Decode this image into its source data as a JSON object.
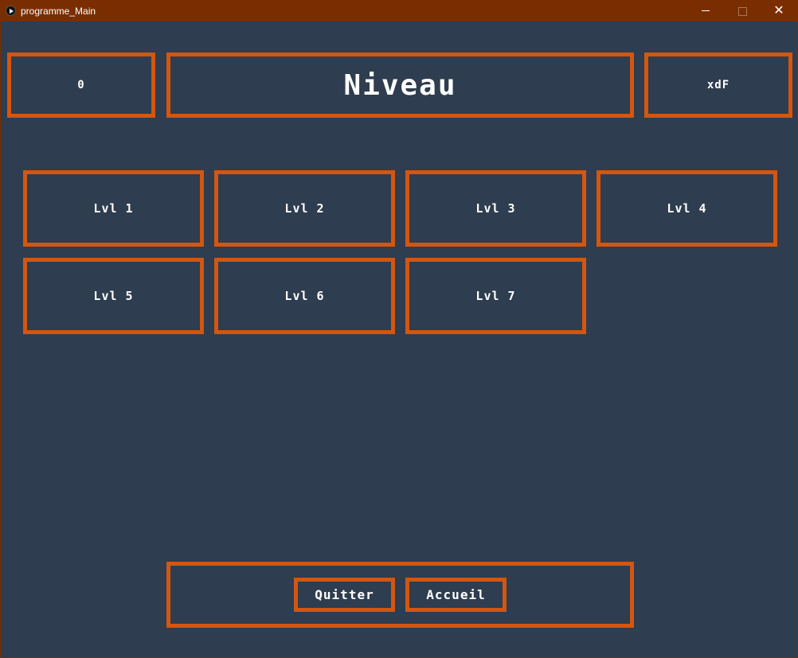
{
  "window": {
    "title": "programme_Main",
    "minimize_glyph": "minimize-icon",
    "maximize_glyph": "maximize-icon",
    "close_glyph": "✕"
  },
  "header": {
    "left_value": "0",
    "title": "Niveau",
    "right_value": "xdF"
  },
  "levels": [
    {
      "label": "Lvl 1"
    },
    {
      "label": "Lvl 2"
    },
    {
      "label": "Lvl 3"
    },
    {
      "label": "Lvl 4"
    },
    {
      "label": "Lvl 5"
    },
    {
      "label": "Lvl 6"
    },
    {
      "label": "Lvl 7"
    }
  ],
  "footer": {
    "quit_label": "Quitter",
    "home_label": "Accueil"
  },
  "colors": {
    "background": "#2e3d4f",
    "accent": "#d4560f",
    "titlebar": "#7a2e00",
    "text": "#ffffff"
  }
}
